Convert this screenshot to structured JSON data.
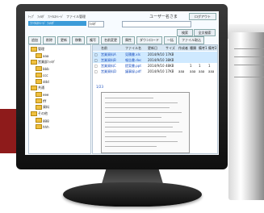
{
  "app": {
    "menu": [
      "ﾄｯﾌﾟ",
      "ﾌｫﾙﾀﾞ",
      "ﾌｧｲﾙｽﾄﾚｰｼﾞ",
      "ファイル管理"
    ],
    "user_label": "ユーザー名さま",
    "logout": "ログアウト",
    "path": "ﾌｧｲﾙｽﾄﾚｰｼﾞ ﾌｫﾙﾀﾞ",
    "path_select": "ﾌｫﾙﾀﾞ",
    "buttons_right": [
      "検索",
      "全文検索"
    ]
  },
  "toolbar": [
    "追加",
    "削除",
    "更新",
    "移動",
    "複写",
    "名前変更",
    "属性",
    "ダウンロード",
    "一括",
    "ファイル取込"
  ],
  "tree": [
    {
      "label": "管理",
      "level": 0
    },
    {
      "label": "aaa",
      "level": 1
    },
    {
      "label": "営業部ﾌｫﾙﾀﾞ",
      "level": 0
    },
    {
      "label": "bbb",
      "level": 1
    },
    {
      "label": "ccc",
      "level": 1
    },
    {
      "label": "ddd",
      "level": 1
    },
    {
      "label": "共通",
      "level": 0
    },
    {
      "label": "eee",
      "level": 1
    },
    {
      "label": "fff",
      "level": 1
    },
    {
      "label": "資料",
      "level": 1
    },
    {
      "label": "その他",
      "level": 0
    },
    {
      "label": "ggg",
      "level": 1
    },
    {
      "label": "hhh",
      "level": 1
    }
  ],
  "list": {
    "columns": [
      "",
      "名前",
      "ファイル名",
      "更新日",
      "サイズ",
      "作成者",
      "種類",
      "備考1",
      "備考2"
    ],
    "rows": [
      [
        "□",
        "営業資料A",
        "見積書.xls",
        "2014/9/10",
        "17KB",
        "",
        "",
        "",
        ""
      ],
      [
        "□",
        "営業資料B",
        "報告書.doc",
        "2014/9/10",
        "38KB",
        "",
        "",
        "",
        ""
      ],
      [
        "□",
        "営業資料C",
        "提案書.ppt",
        "2014/9/10",
        "48KB",
        "1",
        "1",
        "1",
        ""
      ],
      [
        "□",
        "営業資料D",
        "議事録.pdf",
        "2014/9/10",
        "17KB",
        "aaa",
        "aaa",
        "aaa",
        "aaa"
      ]
    ],
    "pager": "1/23"
  },
  "colors": {
    "accent": "#3b9bd8",
    "selected_row": "#cfe9ff",
    "header": "#d6e5f2",
    "brand_red": "#8e1b1b"
  }
}
